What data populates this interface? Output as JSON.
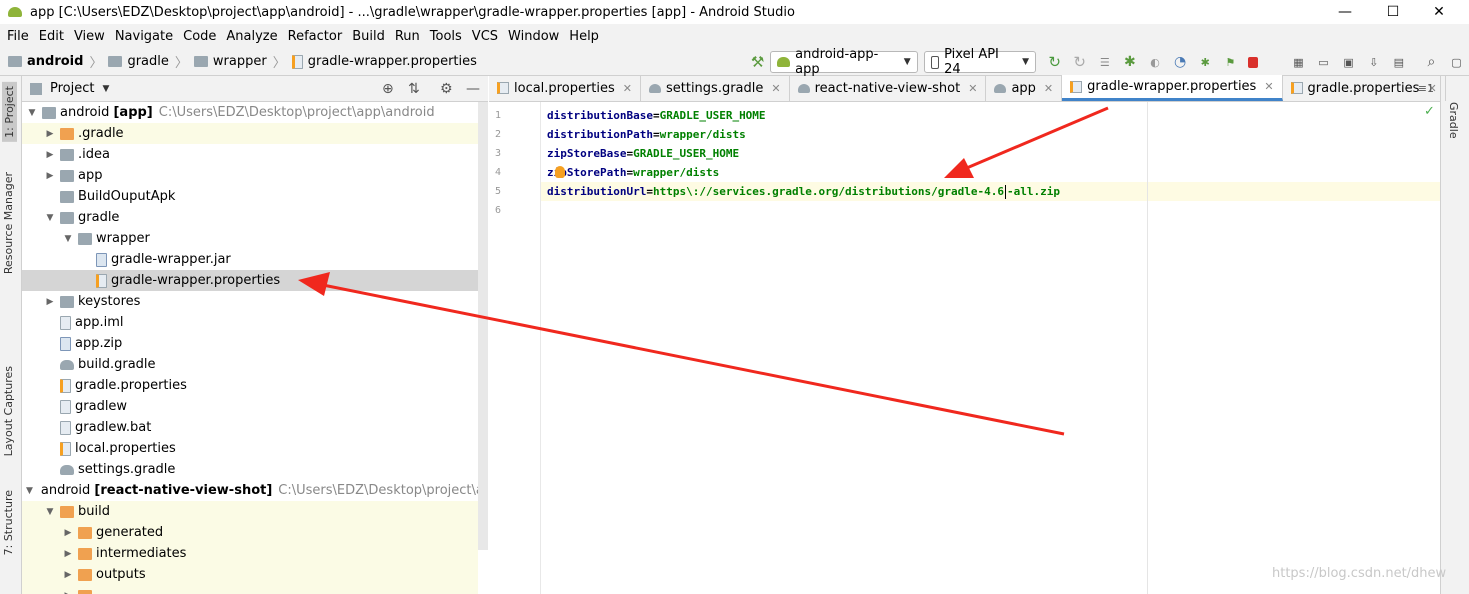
{
  "window": {
    "title": "app [C:\\Users\\EDZ\\Desktop\\project\\app\\android] - ...\\gradle\\wrapper\\gradle-wrapper.properties [app] - Android Studio",
    "minimize": "—",
    "maximize": "☐",
    "close": "✕"
  },
  "menu": [
    "File",
    "Edit",
    "View",
    "Navigate",
    "Code",
    "Analyze",
    "Refactor",
    "Build",
    "Run",
    "Tools",
    "VCS",
    "Window",
    "Help"
  ],
  "breadcrumb": {
    "root": "android",
    "items": [
      "gradle",
      "wrapper",
      "gradle-wrapper.properties"
    ]
  },
  "toolbar": {
    "run_config": "android-app-app",
    "device": "Pixel API 24"
  },
  "side_tabs": {
    "project": "1: Project",
    "resource_manager": "Resource Manager",
    "layout_captures": "Layout Captures",
    "structure": "7: Structure",
    "gradle": "Gradle"
  },
  "project_panel": {
    "title": "Project"
  },
  "tree": {
    "root1": {
      "name": "android",
      "tag": "[app]",
      "path": "C:\\Users\\EDZ\\Desktop\\project\\app\\android"
    },
    "gradle_dir": ".gradle",
    "idea_dir": ".idea",
    "app_dir": "app",
    "build_output": "BuildOuputApk",
    "gradle": "gradle",
    "wrapper": "wrapper",
    "wrapper_jar": "gradle-wrapper.jar",
    "wrapper_props": "gradle-wrapper.properties",
    "keystores": "keystores",
    "app_iml": "app.iml",
    "app_zip": "app.zip",
    "build_gradle": "build.gradle",
    "gradle_properties": "gradle.properties",
    "gradlew": "gradlew",
    "gradlew_bat": "gradlew.bat",
    "local_properties": "local.properties",
    "settings_gradle": "settings.gradle",
    "root2": {
      "name": "android",
      "tag": "[react-native-view-shot]",
      "path": "C:\\Users\\EDZ\\Desktop\\project\\app\\nc"
    },
    "build": "build",
    "generated": "generated",
    "intermediates": "intermediates",
    "outputs": "outputs"
  },
  "tabs": [
    "local.properties",
    "settings.gradle",
    "react-native-view-shot",
    "app",
    "gradle-wrapper.properties",
    "gradle.properties"
  ],
  "tabs_more": "≡1",
  "editor": {
    "line_numbers": [
      "1",
      "2",
      "3",
      "4",
      "5",
      "6"
    ],
    "lines": [
      {
        "key": "distributionBase",
        "eq": "=",
        "val": "GRADLE_USER_HOME"
      },
      {
        "key": "distributionPath",
        "eq": "=",
        "val": "wrapper/dists"
      },
      {
        "key": "zipStoreBase",
        "eq": "=",
        "val": "GRADLE_USER_HOME"
      },
      {
        "key": "zipStorePath",
        "eq": "=",
        "val": "wrapper/dists"
      },
      {
        "key": "distributionUrl",
        "eq": "=",
        "val_a": "https\\://services.gradle.org/distributions/gradle-4.",
        "val_b": "6",
        "val_c": "-all.zip"
      }
    ]
  },
  "watermark": "https://blog.csdn.net/dhew",
  "colors": {
    "annotation_arrow": "#f0281e",
    "key": "#000080",
    "value": "#008000"
  }
}
